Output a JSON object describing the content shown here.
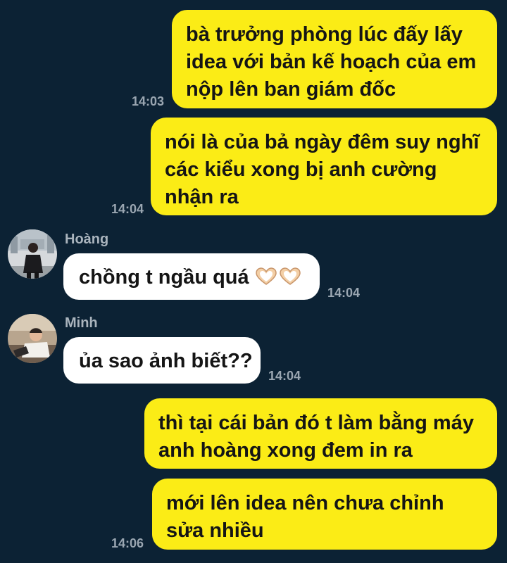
{
  "messages": [
    {
      "side": "out",
      "text": "bà trưởng phòng lúc đấy lấy idea với bản kế hoạch của em nộp lên ban giám đốc",
      "time": "14:03"
    },
    {
      "side": "out",
      "text": "nói là của bả ngày đêm suy nghĩ các kiểu xong bị anh cường nhận ra",
      "time": "14:04"
    },
    {
      "side": "in",
      "sender": "Hoàng",
      "text": "chồng t ngầu quá",
      "emoji": "hand-heart-icon x2",
      "time": "14:04"
    },
    {
      "side": "in",
      "sender": "Minh",
      "text": "ủa sao ảnh biết??",
      "time": "14:04"
    },
    {
      "side": "out",
      "text": "thì tại cái bản đó t làm bằng máy anh hoàng xong đem in ra",
      "time": ""
    },
    {
      "side": "out",
      "text": "mới lên idea nên chưa chỉnh sửa nhiều",
      "time": "14:06"
    }
  ],
  "colors": {
    "background": "#0c2234",
    "outgoing_bubble": "#fbec16",
    "incoming_bubble": "#ffffff",
    "timestamp": "#9aa6b1"
  }
}
